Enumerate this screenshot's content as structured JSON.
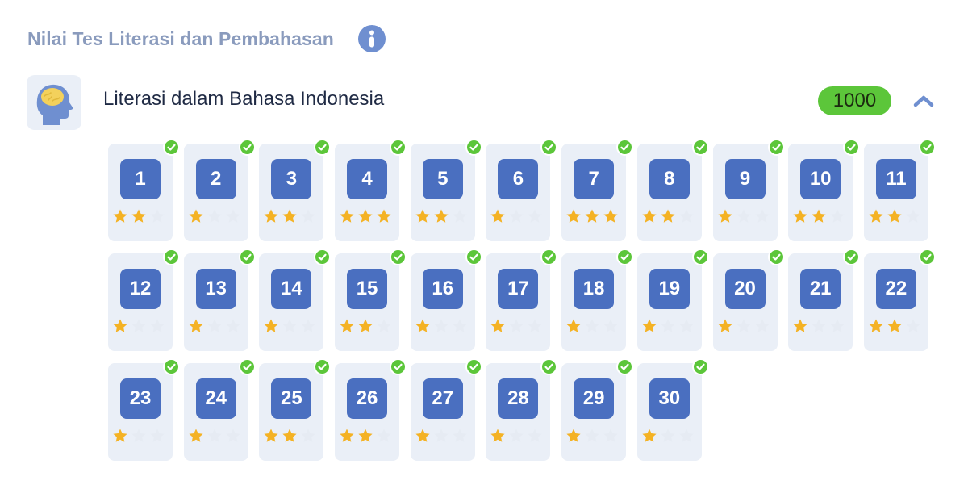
{
  "header": {
    "title": "Nilai Tes Literasi dan Pembahasan",
    "info_icon": "info-icon"
  },
  "subject": {
    "title": "Literasi dalam Bahasa Indonesia",
    "score": "1000",
    "icon": "head-brain-icon",
    "expanded": true
  },
  "colors": {
    "tile": "#4a6fc0",
    "card_bg": "#eaeff7",
    "check": "#5cc63a",
    "star_on": "#f4b224",
    "star_off": "#e6ebf3",
    "badge": "#5cc63a"
  },
  "questions": [
    {
      "number": "1",
      "stars": 2,
      "done": true
    },
    {
      "number": "2",
      "stars": 1,
      "done": true
    },
    {
      "number": "3",
      "stars": 2,
      "done": true
    },
    {
      "number": "4",
      "stars": 3,
      "done": true
    },
    {
      "number": "5",
      "stars": 2,
      "done": true
    },
    {
      "number": "6",
      "stars": 1,
      "done": true
    },
    {
      "number": "7",
      "stars": 3,
      "done": true
    },
    {
      "number": "8",
      "stars": 2,
      "done": true
    },
    {
      "number": "9",
      "stars": 1,
      "done": true
    },
    {
      "number": "10",
      "stars": 2,
      "done": true
    },
    {
      "number": "11",
      "stars": 2,
      "done": true
    },
    {
      "number": "12",
      "stars": 1,
      "done": true
    },
    {
      "number": "13",
      "stars": 1,
      "done": true
    },
    {
      "number": "14",
      "stars": 1,
      "done": true
    },
    {
      "number": "15",
      "stars": 2,
      "done": true
    },
    {
      "number": "16",
      "stars": 1,
      "done": true
    },
    {
      "number": "17",
      "stars": 1,
      "done": true
    },
    {
      "number": "18",
      "stars": 1,
      "done": true
    },
    {
      "number": "19",
      "stars": 1,
      "done": true
    },
    {
      "number": "20",
      "stars": 1,
      "done": true
    },
    {
      "number": "21",
      "stars": 1,
      "done": true
    },
    {
      "number": "22",
      "stars": 2,
      "done": true
    },
    {
      "number": "23",
      "stars": 1,
      "done": true
    },
    {
      "number": "24",
      "stars": 1,
      "done": true
    },
    {
      "number": "25",
      "stars": 2,
      "done": true
    },
    {
      "number": "26",
      "stars": 2,
      "done": true
    },
    {
      "number": "27",
      "stars": 1,
      "done": true
    },
    {
      "number": "28",
      "stars": 1,
      "done": true
    },
    {
      "number": "29",
      "stars": 1,
      "done": true
    },
    {
      "number": "30",
      "stars": 1,
      "done": true
    }
  ]
}
